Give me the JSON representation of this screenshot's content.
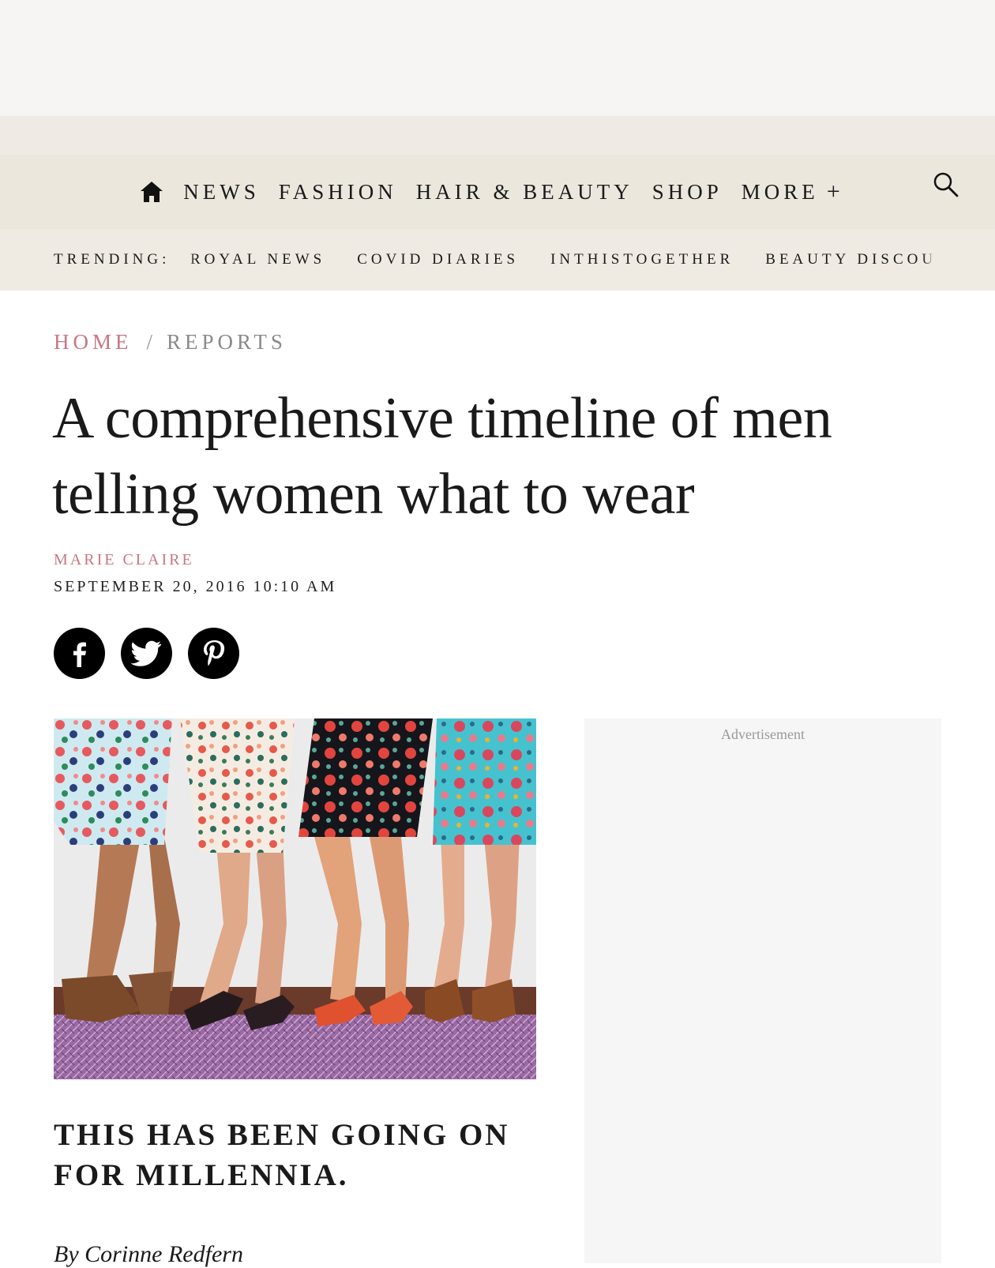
{
  "nav": {
    "items": [
      {
        "label": "NEWS"
      },
      {
        "label": "FASHION"
      },
      {
        "label": "HAIR & BEAUTY"
      },
      {
        "label": "SHOP"
      },
      {
        "label": "MORE"
      }
    ],
    "more_icon": "+",
    "home_icon": "home-icon",
    "search_icon": "search-icon"
  },
  "trending": {
    "label": "TRENDING:",
    "items": [
      {
        "label": "ROYAL NEWS"
      },
      {
        "label": "COVID DIARIES"
      },
      {
        "label": "INTHISTOGETHER"
      },
      {
        "label": "BEAUTY DISCOU"
      }
    ]
  },
  "breadcrumb": {
    "home": "HOME",
    "separator": "/",
    "current": "REPORTS"
  },
  "article": {
    "title": "A comprehensive timeline of men telling women what to wear",
    "author": "MARIE CLAIRE",
    "date": "SEPTEMBER 20, 2016 10:10 AM",
    "subheading": "THIS HAS BEEN GOING ON FOR MILLENNIA.",
    "byline": "By Corinne Redfern"
  },
  "share": {
    "icons": [
      "facebook-icon",
      "twitter-icon",
      "pinterest-icon"
    ]
  },
  "ad": {
    "label": "Advertisement"
  },
  "colors": {
    "accent": "#c77784",
    "nav_bg": "#ebe7dd",
    "trending_bg": "#efebe3"
  }
}
